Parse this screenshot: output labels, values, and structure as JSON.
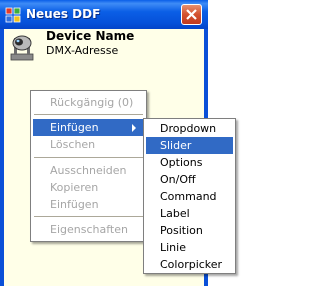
{
  "window": {
    "title": "Neues DDF",
    "close_label": "Close"
  },
  "device": {
    "name": "Device Name",
    "address_label": "DMX-Adresse"
  },
  "context_menu": {
    "items": [
      {
        "label": "Rückgängig (0)",
        "enabled": false
      },
      {
        "label": "Einfügen",
        "enabled": true,
        "highlighted": true,
        "has_submenu": true
      },
      {
        "label": "Löschen",
        "enabled": false
      },
      {
        "label": "Ausschneiden",
        "enabled": false
      },
      {
        "label": "Kopieren",
        "enabled": false
      },
      {
        "label": "Einfügen",
        "enabled": false
      },
      {
        "label": "Eigenschaften",
        "enabled": false
      }
    ]
  },
  "submenu": {
    "items": [
      {
        "label": "Dropdown"
      },
      {
        "label": "Slider",
        "highlighted": true
      },
      {
        "label": "Options"
      },
      {
        "label": "On/Off"
      },
      {
        "label": "Command"
      },
      {
        "label": "Label"
      },
      {
        "label": "Position"
      },
      {
        "label": "Linie"
      },
      {
        "label": "Colorpicker"
      }
    ]
  },
  "colors": {
    "titlebar": "#0550d9",
    "client_background": "#ffffe8",
    "highlight": "#316ac5",
    "disabled_text": "#a6a6a6"
  }
}
